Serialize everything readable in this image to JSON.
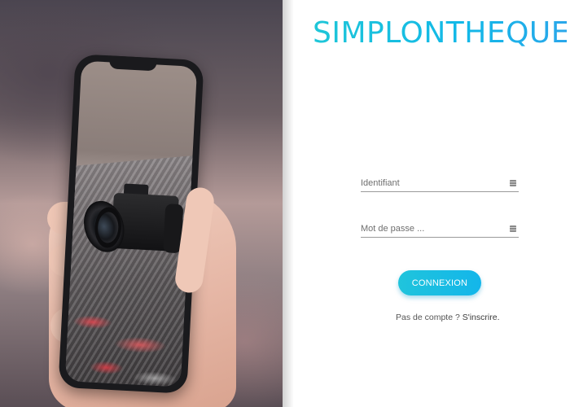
{
  "brand": {
    "name": "SIMPLONTHEQUE"
  },
  "login": {
    "username_placeholder": "Identifiant",
    "username_value": "",
    "password_placeholder": "Mot de passe ...",
    "password_value": "",
    "submit_label": "CONNEXION",
    "no_account_text": "Pas de compte ?",
    "signup_link": "S'inscrire."
  },
  "icons": {
    "username_field": "autofill-key-icon",
    "password_field": "autofill-key-icon"
  },
  "colors": {
    "accent": "#1ec6d8",
    "accent_secondary": "#13b6ea",
    "text": "#555555",
    "underline": "#9b9b9b"
  }
}
